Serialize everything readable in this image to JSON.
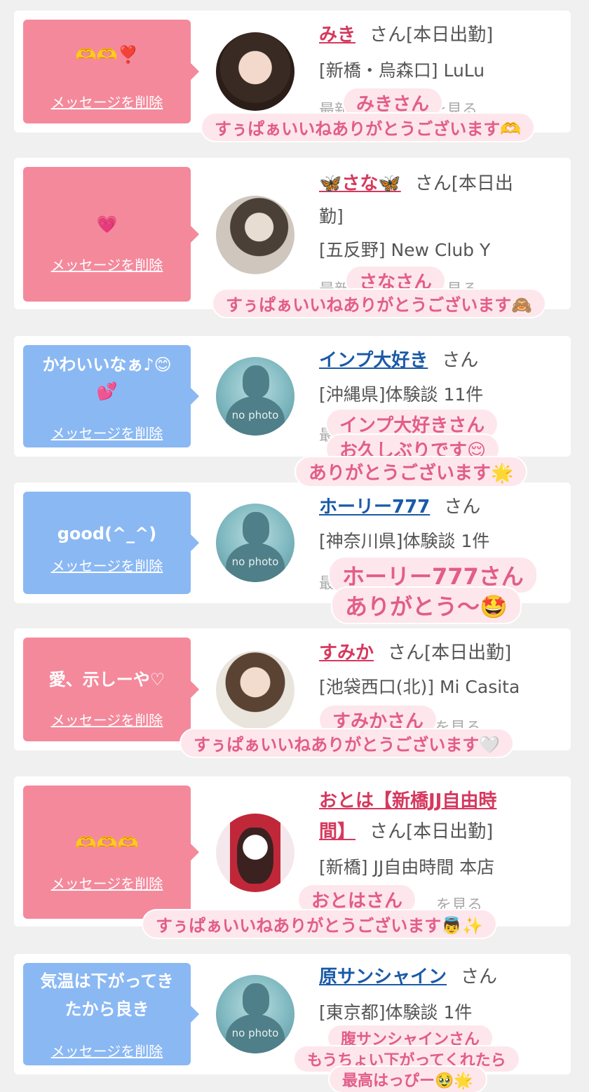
{
  "delete_label": "メッセージを削除",
  "san_label": "さん",
  "cards": [
    {
      "message": "🫶🫶❣️",
      "name": "みき",
      "suffix": "[本日出勤]",
      "info": "[新橋・烏森口] LuLu",
      "cut": "最新",
      "cut2": "を見る",
      "sticker_1": "みきさん",
      "sticker_2": "すぅぱぁいいねありがとうございます🫶"
    },
    {
      "message": "💗",
      "name": "🦋さな🦋",
      "suffix": "[本日出",
      "suffix2": "勤]",
      "info": "[五反野] New Club Y",
      "cut": "最新",
      "cut2": "を見る",
      "sticker_1": "さなさん",
      "sticker_2": "すぅぱぁいいねありがとうございます🙈"
    },
    {
      "message_1": "かわいいなぁ♪😊",
      "message_2": "💕",
      "name": "インプ大好き",
      "info": "[沖縄県]体験談 11件",
      "cut": "最",
      "sticker_1": "インプ大好きさん",
      "sticker_2": "お久しぶりです😌",
      "sticker_3": "ありがとうございます🌟"
    },
    {
      "message": "good(^_^)",
      "name": "ホーリー777",
      "info": "[神奈川県]体験談 1件",
      "cut": "最",
      "sticker_1": "ホーリー777さん",
      "sticker_2": "ありがとう〜🤩"
    },
    {
      "message": "愛、示しーや♡",
      "name": "すみか",
      "suffix": "[本日出勤]",
      "info": "[池袋西口(北)] Mi Casita",
      "cut2": "を見る",
      "sticker_1": "すみかさん",
      "sticker_2": "すぅぱぁいいねありがとうございます🤍"
    },
    {
      "message": "🫶🫶🫶",
      "name_1": "おとは【新橋JJ自由時",
      "name_2": "間】",
      "suffix": "[本日出勤]",
      "info": "[新橋] JJ自由時間 本店",
      "cut2": "を見る",
      "sticker_1": "おとはさん",
      "sticker_2": "すぅぱぁいいねありがとうございます👼✨"
    },
    {
      "message_1": "気温は下がってき",
      "message_2": "たから良き",
      "name": "原サンシャイン",
      "info": "[東京都]体験談 1件",
      "sticker_1": "腹サンシャインさん",
      "sticker_2": "もうちょい下がってくれたら",
      "sticker_3": "最高はっぴー🥹🌟"
    }
  ],
  "nophoto_label": "no photo",
  "colors": {
    "pink": "#f4899c",
    "blue": "#8ab8f3",
    "name_pink": "#d6385e",
    "name_blue": "#1a5aa8",
    "sticker_text": "#e25d8a"
  }
}
